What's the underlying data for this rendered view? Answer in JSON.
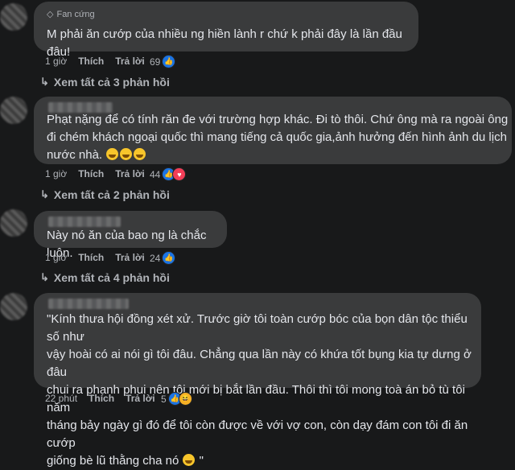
{
  "comments": [
    {
      "badge": "Fan cứng",
      "text": "M phải ăn cướp của nhiều ng hiền lành r chứ k phải đây là lần đầu đâu!",
      "time": "1 giờ",
      "like": "Thích",
      "reply": "Trả lời",
      "reactions": "69",
      "reaction_icons": [
        "like-icon"
      ],
      "view_replies": "Xem tất cả 3 phản hồi"
    },
    {
      "text": "Phạt nặng để có tính răn đe với trường hợp khác. Đi tò thôi. Chứ ông mà ra ngoài ông\nđi chém khách ngoại quốc thì mang tiếng cả quốc gia,ảnh hưởng đến hình ảnh du lịch\nnước nhà.",
      "time": "1 giờ",
      "like": "Thích",
      "reply": "Trả lời",
      "reactions": "44",
      "reaction_icons": [
        "like-icon",
        "heart-icon"
      ],
      "view_replies": "Xem tất cả 2 phản hồi"
    },
    {
      "text": "Này nó ăn của bao ng là chắc luôn.",
      "time": "1 giờ",
      "like": "Thích",
      "reply": "Trả lời",
      "reactions": "24",
      "reaction_icons": [
        "like-icon"
      ],
      "view_replies": "Xem tất cả 4 phản hồi"
    },
    {
      "text": "\"Kính thưa hội đồng xét xử. Trước giờ tôi toàn cướp bóc của bọn dân tộc thiểu số như\nvậy hoài có ai nói gì tôi đâu. Chẳng qua lần này có khứa tốt bụng kia tự dưng ở đâu\nchui ra phanh phui nên tôi mới bị bắt lần đầu. Thôi thì tôi mong toà án bỏ tù tôi năm\ntháng bảy ngày gì đó để tôi còn được về với vợ con, còn dạy đám con tôi đi ăn cướp\ngiống bè lũ thằng cha nó",
      "text_end": " \"",
      "time": "22 phút",
      "like": "Thích",
      "reply": "Trả lời",
      "reactions": "5",
      "reaction_icons": [
        "like-icon",
        "haha-icon"
      ]
    }
  ]
}
